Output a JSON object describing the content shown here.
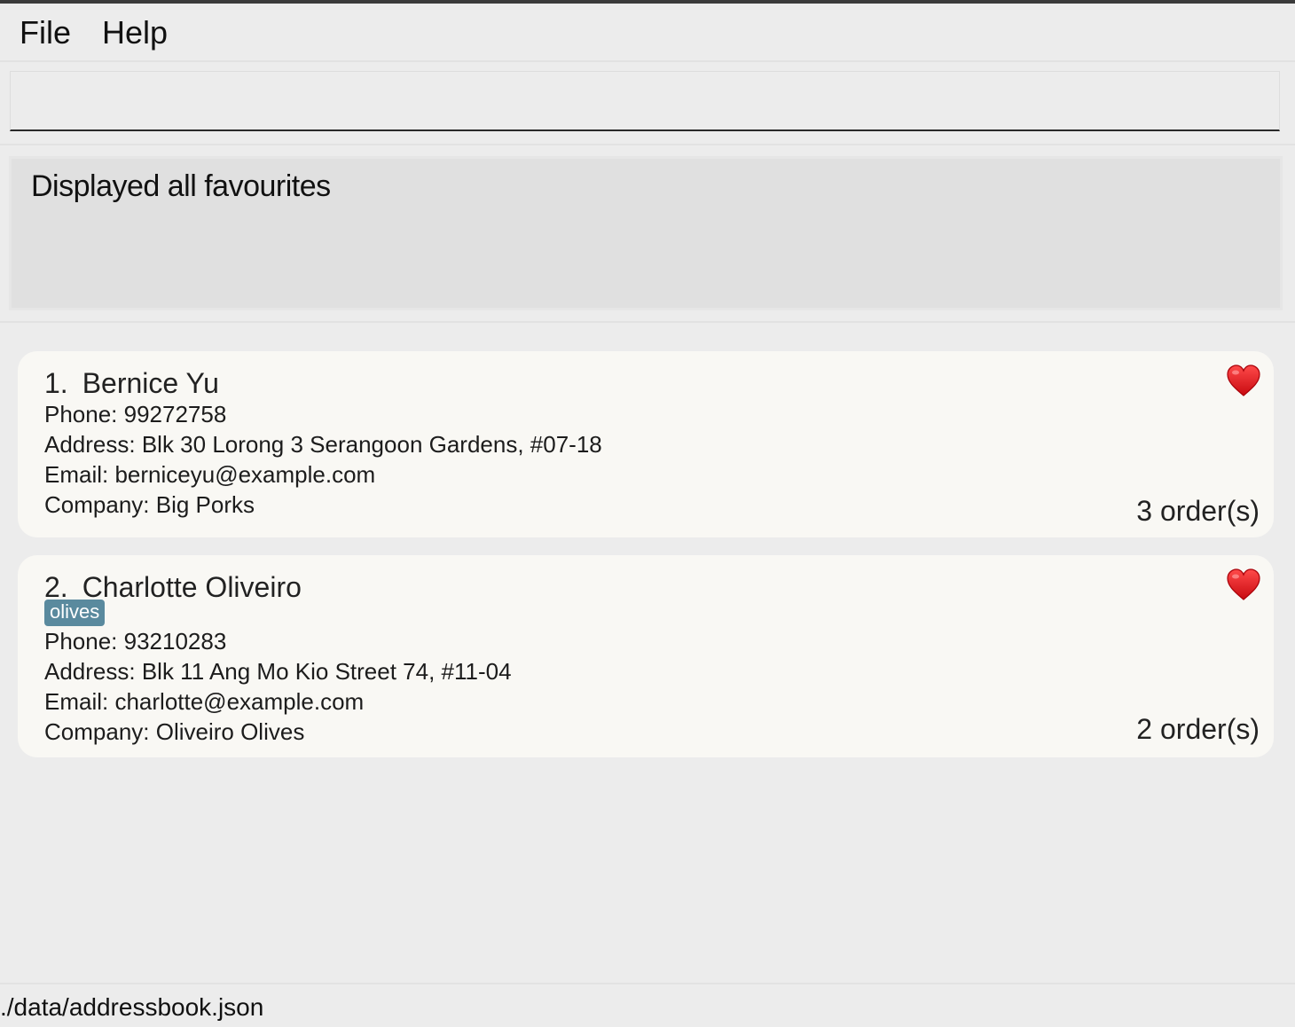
{
  "menu": {
    "file_label": "File",
    "help_label": "Help"
  },
  "command": {
    "value": "",
    "placeholder": ""
  },
  "result": {
    "text": "Displayed all favourites"
  },
  "persons": [
    {
      "index": "1.",
      "name": "Bernice Yu",
      "tag": "",
      "phone": "Phone: 99272758",
      "address": "Address: Blk 30 Lorong 3 Serangoon Gardens, #07-18",
      "email": "Email: berniceyu@example.com",
      "company": "Company: Big Porks",
      "orders": "3 order(s)",
      "favourite_icon": "heart-icon"
    },
    {
      "index": "2.",
      "name": "Charlotte Oliveiro",
      "tag": "olives",
      "phone": "Phone: 93210283",
      "address": "Address: Blk 11 Ang Mo Kio Street 74, #11-04",
      "email": "Email: charlotte@example.com",
      "company": "Company: Oliveiro Olives",
      "orders": "2 order(s)",
      "favourite_icon": "heart-icon"
    }
  ],
  "status": {
    "path": "./data/addressbook.json"
  },
  "colors": {
    "heart": "#e0161c",
    "tag_bg": "#5a8a9e",
    "card_bg": "#f9f8f4"
  }
}
